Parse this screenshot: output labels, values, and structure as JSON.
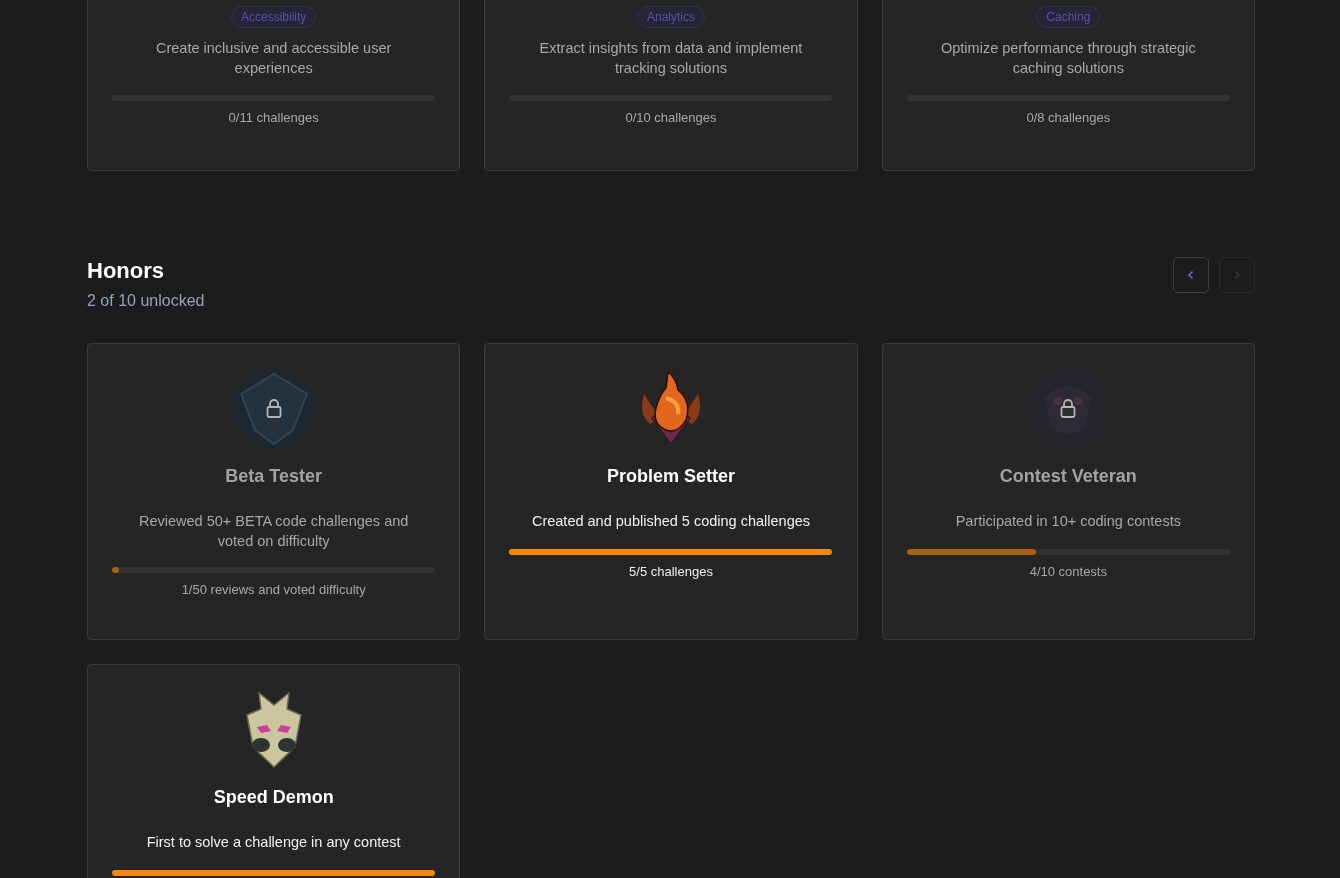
{
  "categories": [
    {
      "tag": "Accessibility",
      "description": "Create inclusive and accessible user experiences",
      "level": 0,
      "progress": "0/11 challenges"
    },
    {
      "tag": "Analytics",
      "description": "Extract insights from data and implement tracking solutions",
      "level": 0,
      "progress": "0/10 challenges"
    },
    {
      "tag": "Caching",
      "description": "Optimize performance through strategic caching solutions",
      "level": 0,
      "progress": "0/8 challenges"
    }
  ],
  "honors": {
    "title": "Honors",
    "subtitle": "2 of 10 unlocked",
    "nav": [
      {
        "kind": "prev",
        "disabled": false
      },
      {
        "kind": "next",
        "disabled": true
      }
    ],
    "items": [
      {
        "kind": "shield",
        "unlocked": false,
        "name": "Beta Tester",
        "description": "Reviewed 50+ BETA code challenges and voted on difficulty",
        "level": 0.02,
        "progress": "1/50 reviews and voted difficulty"
      },
      {
        "kind": "flame",
        "unlocked": true,
        "name": "Problem Setter",
        "description": "Created and published 5 coding challenges",
        "level": 1,
        "progress": "5/5 challenges"
      },
      {
        "kind": "skull",
        "unlocked": false,
        "name": "Contest Veteran",
        "description": "Participated in 10+ coding contests",
        "level": 0.4,
        "progress": "4/10 contests"
      },
      {
        "kind": "mask",
        "unlocked": true,
        "name": "Speed Demon",
        "description": "First to solve a challenge in any contest",
        "level": 1
      }
    ]
  }
}
